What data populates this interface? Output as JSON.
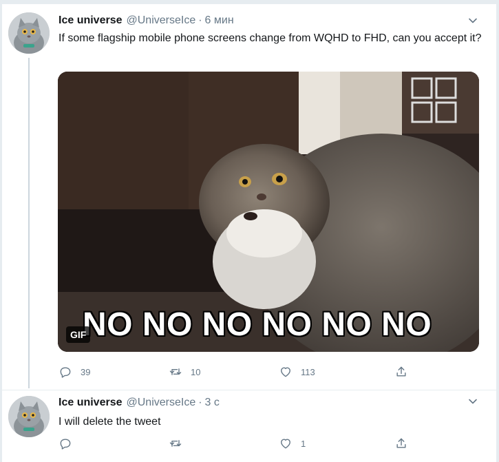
{
  "tweets": [
    {
      "author_name": "Ice universe",
      "handle": "@UniverseIce",
      "separator": "·",
      "time": "6 мин",
      "text": "If some flagship mobile phone screens change from WQHD to FHD, can you accept it?",
      "media": {
        "caption": "NO NO NO NO NO NO",
        "badge": "GIF"
      },
      "reply_count": "39",
      "retweet_count": "10",
      "like_count": "113"
    },
    {
      "author_name": "Ice universe",
      "handle": "@UniverseIce",
      "separator": "·",
      "time": "3 с",
      "text": "I will delete the tweet",
      "reply_count": "",
      "retweet_count": "",
      "like_count": "1"
    }
  ],
  "icons": {
    "reply": "reply-icon",
    "retweet": "retweet-icon",
    "like": "heart-icon",
    "share": "share-icon",
    "menu": "chevron-down-icon"
  },
  "colors": {
    "text_primary": "#14171a",
    "text_secondary": "#657786",
    "border": "#e6ecf0",
    "thread_line": "#ccd6dd"
  }
}
